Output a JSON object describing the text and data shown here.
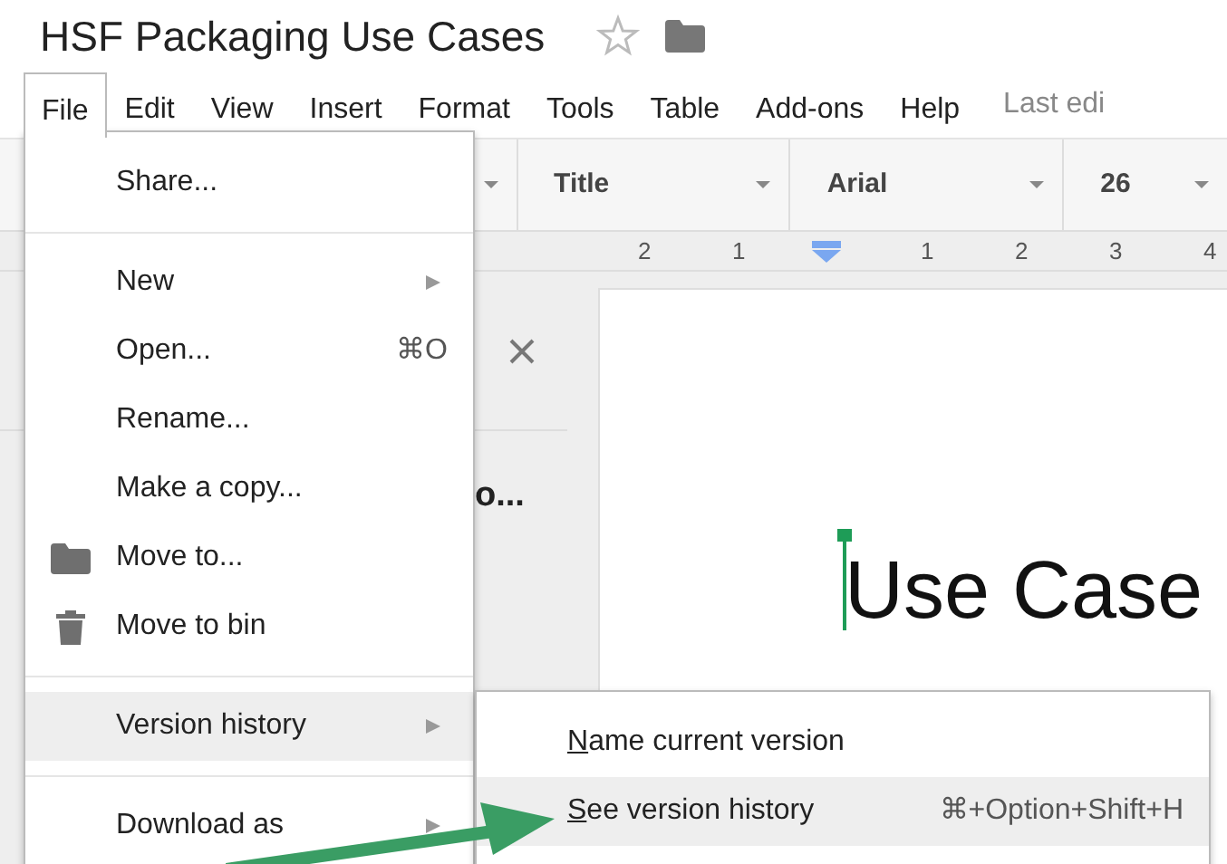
{
  "document": {
    "title": "HSF Packaging Use Cases",
    "starred": false
  },
  "menu_bar": [
    {
      "label": "File",
      "selected": true
    },
    {
      "label": "Edit",
      "selected": false
    },
    {
      "label": "View",
      "selected": false
    },
    {
      "label": "Insert",
      "selected": false
    },
    {
      "label": "Format",
      "selected": false
    },
    {
      "label": "Tools",
      "selected": false
    },
    {
      "label": "Table",
      "selected": false
    },
    {
      "label": "Add-ons",
      "selected": false
    },
    {
      "label": "Help",
      "selected": false
    }
  ],
  "last_edit": "Last edi",
  "toolbar": [
    {
      "label": "Title"
    },
    {
      "label": "Arial"
    },
    {
      "label": "26"
    }
  ],
  "ruler": [
    "2",
    "1",
    "1",
    "2",
    "3",
    "4"
  ],
  "outline_panel": {
    "fragment": "o..."
  },
  "page": {
    "lines": [
      "Use Case"
    ]
  },
  "file_menu": [
    {
      "kind": "item",
      "label": "Share...",
      "selected": false
    },
    {
      "kind": "divider"
    },
    {
      "kind": "submenu",
      "label": "New",
      "selected": false
    },
    {
      "kind": "item",
      "label": "Open...",
      "shortcut": "⌘O",
      "selected": false
    },
    {
      "kind": "item",
      "label": "Rename...",
      "selected": false
    },
    {
      "kind": "item",
      "label": "Make a copy...",
      "selected": false
    },
    {
      "kind": "move",
      "label": "Move to...",
      "selected": false
    },
    {
      "kind": "delete",
      "label": "Move to bin",
      "selected": false
    },
    {
      "kind": "divider"
    },
    {
      "kind": "submenu",
      "label": "Version history",
      "selected": true
    },
    {
      "kind": "divider"
    },
    {
      "kind": "submenu",
      "label": "Download as",
      "selected": false
    }
  ],
  "submenu": [
    {
      "label": "Name current version",
      "selected": false
    },
    {
      "label": "See version history",
      "shortcut": "⌘+Option+Shift+H",
      "selected": true
    }
  ]
}
